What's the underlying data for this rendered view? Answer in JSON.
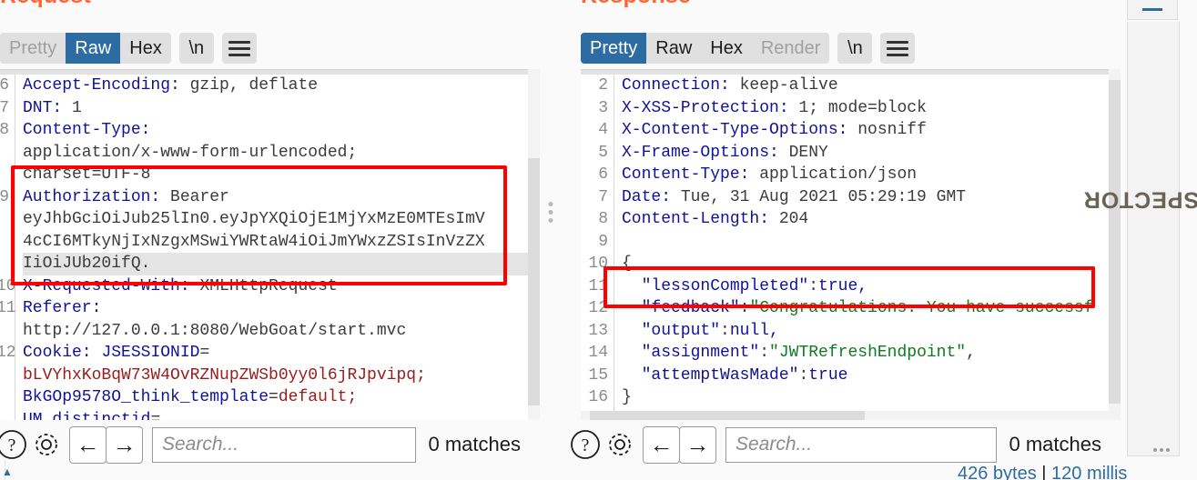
{
  "request": {
    "title": "Request",
    "tabs": [
      {
        "label": "Pretty",
        "state": "disabled"
      },
      {
        "label": "Raw",
        "state": "active"
      },
      {
        "label": "Hex",
        "state": "normal"
      }
    ],
    "newline_button": "\\n",
    "menu_icon": "hamburger-icon",
    "lines": [
      {
        "num": "6",
        "segments": [
          {
            "t": "Accept-Encoding:",
            "c": "k"
          },
          {
            "t": " gzip, deflate",
            "c": "v"
          }
        ]
      },
      {
        "num": "7",
        "segments": [
          {
            "t": "DNT:",
            "c": "k"
          },
          {
            "t": " 1",
            "c": "v"
          }
        ]
      },
      {
        "num": "8",
        "segments": [
          {
            "t": "Content-Type:",
            "c": "k"
          }
        ]
      },
      {
        "num": "",
        "segments": [
          {
            "t": "application/x-www-form-urlencoded;",
            "c": "v"
          }
        ]
      },
      {
        "num": "",
        "segments": [
          {
            "t": "charset=UTF-8",
            "c": "v"
          }
        ]
      },
      {
        "num": "9",
        "segments": [
          {
            "t": "Authorization:",
            "c": "k"
          },
          {
            "t": " Bearer",
            "c": "v"
          }
        ]
      },
      {
        "num": "",
        "segments": [
          {
            "t": "eyJhbGciOiJub25lIn0.eyJpYXQiOjE1MjYxMzE0MTEsImV",
            "c": "v"
          }
        ]
      },
      {
        "num": "",
        "segments": [
          {
            "t": "4cCI6MTkyNjIxNzgxMSwiYWRtaW4iOiJmYWxzZSIsInVzZX",
            "c": "v"
          }
        ]
      },
      {
        "num": "",
        "highlight": true,
        "segments": [
          {
            "t": "IiOiJUb20ifQ.",
            "c": "v"
          }
        ]
      },
      {
        "num": "10",
        "segments": [
          {
            "t": "X-Requested-With:",
            "c": "k"
          },
          {
            "t": " XMLHttpRequest",
            "c": "v"
          }
        ]
      },
      {
        "num": "11",
        "segments": [
          {
            "t": "Referer:",
            "c": "k"
          }
        ]
      },
      {
        "num": "",
        "segments": [
          {
            "t": "http://127.0.0.1:8080/WebGoat/start.mvc",
            "c": "v"
          }
        ]
      },
      {
        "num": "12",
        "segments": [
          {
            "t": "Cookie:",
            "c": "k"
          },
          {
            "t": " ",
            "c": "v"
          },
          {
            "t": "JSESSIONID",
            "c": "k"
          },
          {
            "t": "=",
            "c": "v"
          }
        ]
      },
      {
        "num": "",
        "segments": [
          {
            "t": "bLVYhxKoBqW73W4OvRZNupZWSb0yy0l6jRJpvipq;",
            "c": "red"
          }
        ]
      },
      {
        "num": "",
        "segments": [
          {
            "t": "BkGOp9578O_think_template",
            "c": "k"
          },
          {
            "t": "=",
            "c": "v"
          },
          {
            "t": "default;",
            "c": "red"
          }
        ]
      },
      {
        "num": "",
        "segments": [
          {
            "t": "UM_distinctid",
            "c": "k"
          },
          {
            "t": "=",
            "c": "v"
          }
        ]
      }
    ],
    "annotation": "authorization-header-highlight",
    "bottom": {
      "help_icon": "question-mark-icon",
      "settings_icon": "gear-icon",
      "prev_icon": "arrow-left-icon",
      "next_icon": "arrow-right-icon",
      "search_placeholder": "Search...",
      "search_value": "",
      "matches": "0 matches"
    }
  },
  "response": {
    "title": "Response",
    "tabs": [
      {
        "label": "Pretty",
        "state": "active"
      },
      {
        "label": "Raw",
        "state": "normal"
      },
      {
        "label": "Hex",
        "state": "normal"
      },
      {
        "label": "Render",
        "state": "disabled"
      }
    ],
    "newline_button": "\\n",
    "menu_icon": "hamburger-icon",
    "lines": [
      {
        "num": "2",
        "segments": [
          {
            "t": "Connection:",
            "c": "k"
          },
          {
            "t": " keep-alive",
            "c": "v"
          }
        ]
      },
      {
        "num": "3",
        "segments": [
          {
            "t": "X-XSS-Protection:",
            "c": "k"
          },
          {
            "t": " 1; mode=block",
            "c": "v"
          }
        ]
      },
      {
        "num": "4",
        "segments": [
          {
            "t": "X-Content-Type-Options:",
            "c": "k"
          },
          {
            "t": " nosniff",
            "c": "v"
          }
        ]
      },
      {
        "num": "5",
        "segments": [
          {
            "t": "X-Frame-Options:",
            "c": "k"
          },
          {
            "t": " DENY",
            "c": "v"
          }
        ]
      },
      {
        "num": "6",
        "segments": [
          {
            "t": "Content-Type:",
            "c": "k"
          },
          {
            "t": " application/json",
            "c": "v"
          }
        ]
      },
      {
        "num": "7",
        "segments": [
          {
            "t": "Date:",
            "c": "k"
          },
          {
            "t": " Tue, 31 Aug 2021 05:29:19 GMT",
            "c": "v"
          }
        ]
      },
      {
        "num": "8",
        "segments": [
          {
            "t": "Content-Length:",
            "c": "k"
          },
          {
            "t": " 204",
            "c": "v"
          }
        ]
      },
      {
        "num": "9",
        "segments": [
          {
            "t": "",
            "c": "v"
          }
        ]
      },
      {
        "num": "10",
        "segments": [
          {
            "t": "{",
            "c": "v"
          }
        ]
      },
      {
        "num": "11",
        "segments": [
          {
            "t": "  \"lessonCompleted\"",
            "c": "k"
          },
          {
            "t": ":",
            "c": "v"
          },
          {
            "t": "true,",
            "c": "k"
          }
        ]
      },
      {
        "num": "12",
        "segments": [
          {
            "t": "  \"feedback\"",
            "c": "k"
          },
          {
            "t": ":",
            "c": "v"
          },
          {
            "t": "\"Congratulations. You have successf",
            "c": "str"
          }
        ]
      },
      {
        "num": "13",
        "segments": [
          {
            "t": "  \"output\"",
            "c": "k"
          },
          {
            "t": ":",
            "c": "v"
          },
          {
            "t": "null,",
            "c": "k"
          }
        ]
      },
      {
        "num": "14",
        "segments": [
          {
            "t": "  \"assignment\"",
            "c": "k"
          },
          {
            "t": ":",
            "c": "v"
          },
          {
            "t": "\"JWTRefreshEndpoint\"",
            "c": "str"
          },
          {
            "t": ",",
            "c": "v"
          }
        ]
      },
      {
        "num": "15",
        "segments": [
          {
            "t": "  \"attemptWasMade\"",
            "c": "k"
          },
          {
            "t": ":",
            "c": "v"
          },
          {
            "t": "true",
            "c": "k"
          }
        ]
      },
      {
        "num": "16",
        "segments": [
          {
            "t": "}",
            "c": "v"
          }
        ]
      }
    ],
    "annotation": "feedback-field-highlight",
    "bottom": {
      "help_icon": "question-mark-icon",
      "settings_icon": "gear-icon",
      "prev_icon": "arrow-left-icon",
      "next_icon": "arrow-right-icon",
      "search_placeholder": "Search...",
      "search_value": "",
      "matches": "0 matches"
    }
  },
  "inspector": {
    "label": "INSPECTOR",
    "collapse_icon": "minus-icon",
    "grip_icon": "grip-dots-icon"
  },
  "status": {
    "size": "426 bytes",
    "separator": " | ",
    "time": "120 millis"
  },
  "colors": {
    "accent_orange": "#ff6633",
    "tab_active_blue": "#2d6ca2",
    "annotation_red": "#ff0000",
    "header_key_blue": "#11119b",
    "json_string_green": "#0f7a22",
    "cookie_value_red": "#9b1b1b"
  }
}
